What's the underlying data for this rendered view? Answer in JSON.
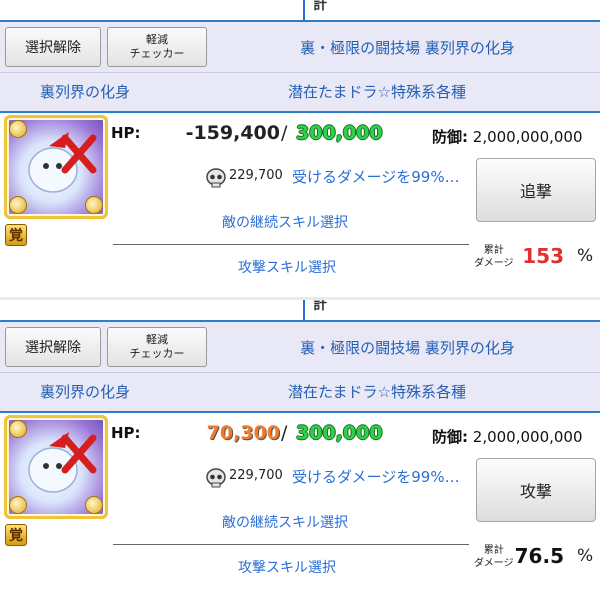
{
  "panels": [
    {
      "top_glyph": "計",
      "clear_button": "選択解除",
      "checker_button": [
        "軽減",
        "チェッカー"
      ],
      "dungeon": "裏・極限の闘技場 裏列界の化身",
      "floor_name": "裏列界の化身",
      "floor_note": "潜在たまドラ☆特殊系各種",
      "hp_label": "HP:",
      "hp_current": "-159,400",
      "hp_slash": "/",
      "hp_max": "300,000",
      "defense_label": "防御:",
      "defense_value": "2,000,000,000",
      "attack_value": "229,700",
      "damage_taken": "受けるダメージを99%…",
      "action_button": "追撃",
      "enemy_skill": "敵の継続スキル選択",
      "attack_skill": "攻撃スキル選択",
      "cumulative_label": [
        "累計",
        "ダメージ"
      ],
      "cumulative_value": "153",
      "percent": "%",
      "awakening": "覚"
    },
    {
      "top_glyph": "計",
      "clear_button": "選択解除",
      "checker_button": [
        "軽減",
        "チェッカー"
      ],
      "dungeon": "裏・極限の闘技場 裏列界の化身",
      "floor_name": "裏列界の化身",
      "floor_note": "潜在たまドラ☆特殊系各種",
      "hp_label": "HP:",
      "hp_current": "70,300",
      "hp_slash": "/",
      "hp_max": "300,000",
      "defense_label": "防御:",
      "defense_value": "2,000,000,000",
      "attack_value": "229,700",
      "damage_taken": "受けるダメージを99%…",
      "action_button": "攻撃",
      "enemy_skill": "敵の継続スキル選択",
      "attack_skill": "攻撃スキル選択",
      "cumulative_label": [
        "累計",
        "ダメージ"
      ],
      "cumulative_value": "76.5",
      "percent": "%",
      "awakening": "覚"
    }
  ],
  "colors": {
    "header_bg": "#e8e8f7",
    "link_blue": "#2b6fd6",
    "hp_max_green": "#2fd14a",
    "hp_positive_orange": "#ee7a2a",
    "cumulative_red": "#e23030"
  },
  "icons": [
    "skull-icon",
    "awakening-icon",
    "monster-portrait",
    "orb-icon"
  ]
}
